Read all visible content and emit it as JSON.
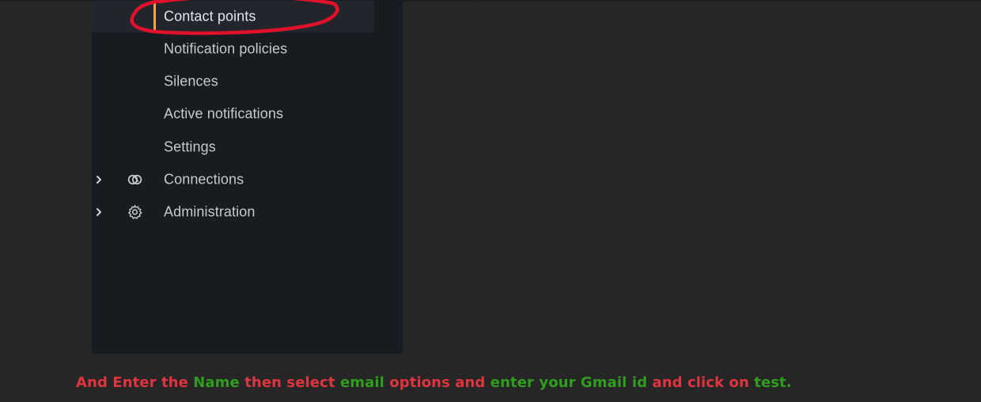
{
  "nav": {
    "items": [
      {
        "label": "Contact points",
        "active": true
      },
      {
        "label": "Notification policies"
      },
      {
        "label": "Silences"
      },
      {
        "label": "Active notifications"
      },
      {
        "label": "Settings"
      },
      {
        "label": "Connections",
        "icon": "connections-icon",
        "expandable": true
      },
      {
        "label": "Administration",
        "icon": "gear-icon",
        "expandable": true
      }
    ]
  },
  "caption": {
    "parts": [
      {
        "text": "And Enter the ",
        "color": "red"
      },
      {
        "text": "Name",
        "color": "green"
      },
      {
        "text": " then select ",
        "color": "red"
      },
      {
        "text": "email",
        "color": "green"
      },
      {
        "text": " options and ",
        "color": "red"
      },
      {
        "text": "enter your Gmail id",
        "color": "green"
      },
      {
        "text": " and click on ",
        "color": "red"
      },
      {
        "text": "test.",
        "color": "green"
      }
    ]
  },
  "colors": {
    "background": "#262626",
    "sidebar": "#181b1f",
    "active_accent": "#f5a442",
    "annotation_red": "#e0112a",
    "caption_red": "#e0343f",
    "caption_green": "#2f9e1e"
  }
}
